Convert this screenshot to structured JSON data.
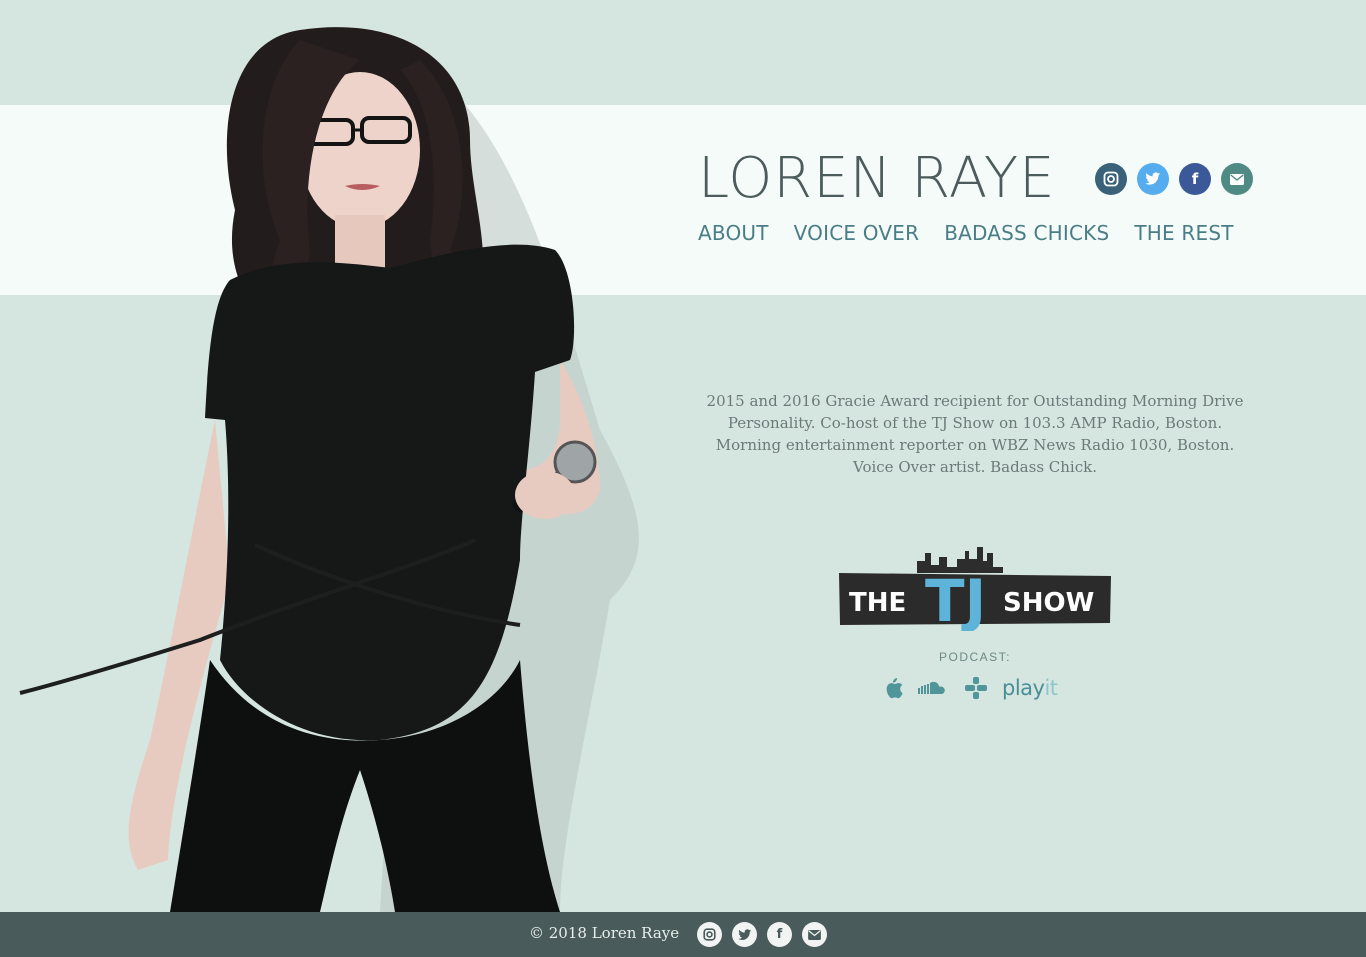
{
  "site": {
    "name": "LOREN RAYE"
  },
  "colors": {
    "background": "#d5e5df",
    "band": "#f5fbf8",
    "nav_text": "#4a7e86",
    "footer": "#4a5b5b",
    "instagram": "#39617a",
    "twitter": "#55acee",
    "facebook": "#3b5998",
    "email": "#4f8a84"
  },
  "social_top": [
    {
      "name": "instagram-icon",
      "glyph": "◎"
    },
    {
      "name": "twitter-icon",
      "glyph": "🐦"
    },
    {
      "name": "facebook-icon",
      "glyph": "f"
    },
    {
      "name": "email-icon",
      "glyph": "✉"
    }
  ],
  "nav": {
    "items": [
      {
        "label": "ABOUT"
      },
      {
        "label": "VOICE OVER"
      },
      {
        "label": "BADASS CHICKS"
      },
      {
        "label": "THE REST"
      }
    ]
  },
  "bio": "2015 and 2016 Gracie Award recipient for Outstanding Morning Drive Personality. Co-host of the TJ Show on 103.3 AMP Radio, Boston. Morning entertainment reporter on WBZ News Radio 1030, Boston. Voice Over artist. Badass Chick.",
  "tj_show": {
    "logo_text_left": "THE",
    "logo_text_mid": "TJ",
    "logo_text_right": "SHOW",
    "podcast_label": "PODCAST:",
    "podcast_links": [
      {
        "name": "apple-podcasts-icon"
      },
      {
        "name": "soundcloud-icon"
      },
      {
        "name": "tunein-icon"
      },
      {
        "name": "playit-link",
        "label_main": "play",
        "label_accent": "it"
      }
    ]
  },
  "footer": {
    "copyright": "© 2018 Loren Raye",
    "social": [
      {
        "name": "instagram-icon"
      },
      {
        "name": "twitter-icon"
      },
      {
        "name": "facebook-icon"
      },
      {
        "name": "email-icon"
      }
    ]
  }
}
